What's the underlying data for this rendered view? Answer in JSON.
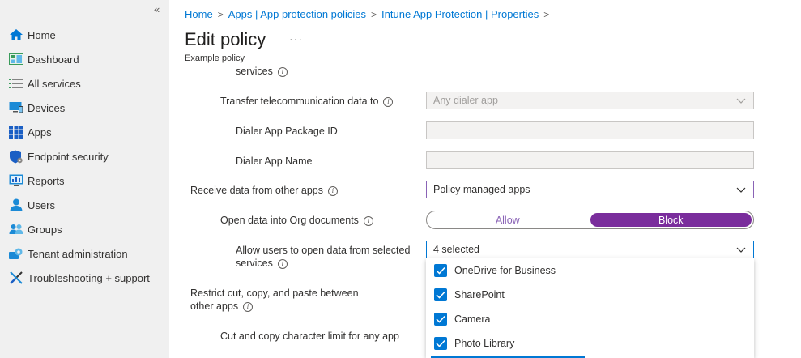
{
  "sidebar": {
    "collapse_label": "«",
    "items": [
      {
        "label": "Home",
        "icon": "home-icon"
      },
      {
        "label": "Dashboard",
        "icon": "dashboard-icon"
      },
      {
        "label": "All services",
        "icon": "list-icon"
      },
      {
        "label": "Devices",
        "icon": "devices-icon"
      },
      {
        "label": "Apps",
        "icon": "apps-icon"
      },
      {
        "label": "Endpoint security",
        "icon": "shield-icon"
      },
      {
        "label": "Reports",
        "icon": "reports-icon"
      },
      {
        "label": "Users",
        "icon": "user-icon"
      },
      {
        "label": "Groups",
        "icon": "groups-icon"
      },
      {
        "label": "Tenant administration",
        "icon": "gear-icon"
      },
      {
        "label": "Troubleshooting + support",
        "icon": "wrench-icon"
      }
    ]
  },
  "breadcrumb": [
    "Home",
    "Apps | App protection policies",
    "Intune App Protection | Properties"
  ],
  "page": {
    "title": "Edit policy",
    "more_label": "···",
    "subtitle": "Example policy"
  },
  "form": {
    "services_top": "services",
    "transfer_label": "Transfer telecommunication data to",
    "transfer_value": "Any dialer app",
    "dialer_pkg_label": "Dialer App Package ID",
    "dialer_name_label": "Dialer App Name",
    "receive_label": "Receive data from other apps",
    "receive_value": "Policy managed apps",
    "open_org_label": "Open data into Org documents",
    "toggle_allow": "Allow",
    "toggle_block": "Block",
    "toggle_selected": "Block",
    "allow_users_label_1": "Allow users to open data from selected",
    "allow_users_label_2": "services",
    "selected_value": "4 selected",
    "restrict_label_1": "Restrict cut, copy, and paste between",
    "restrict_label_2": "other apps",
    "cut_copy_label": "Cut and copy character limit for any app"
  },
  "dropdown_options": [
    {
      "label": "OneDrive for Business",
      "checked": true
    },
    {
      "label": "SharePoint",
      "checked": true
    },
    {
      "label": "Camera",
      "checked": true
    },
    {
      "label": "Photo Library",
      "checked": true
    }
  ],
  "colors": {
    "accent": "#0078d4",
    "purple": "#7a2d9c",
    "sidebar_bg": "#f0f0f0"
  }
}
